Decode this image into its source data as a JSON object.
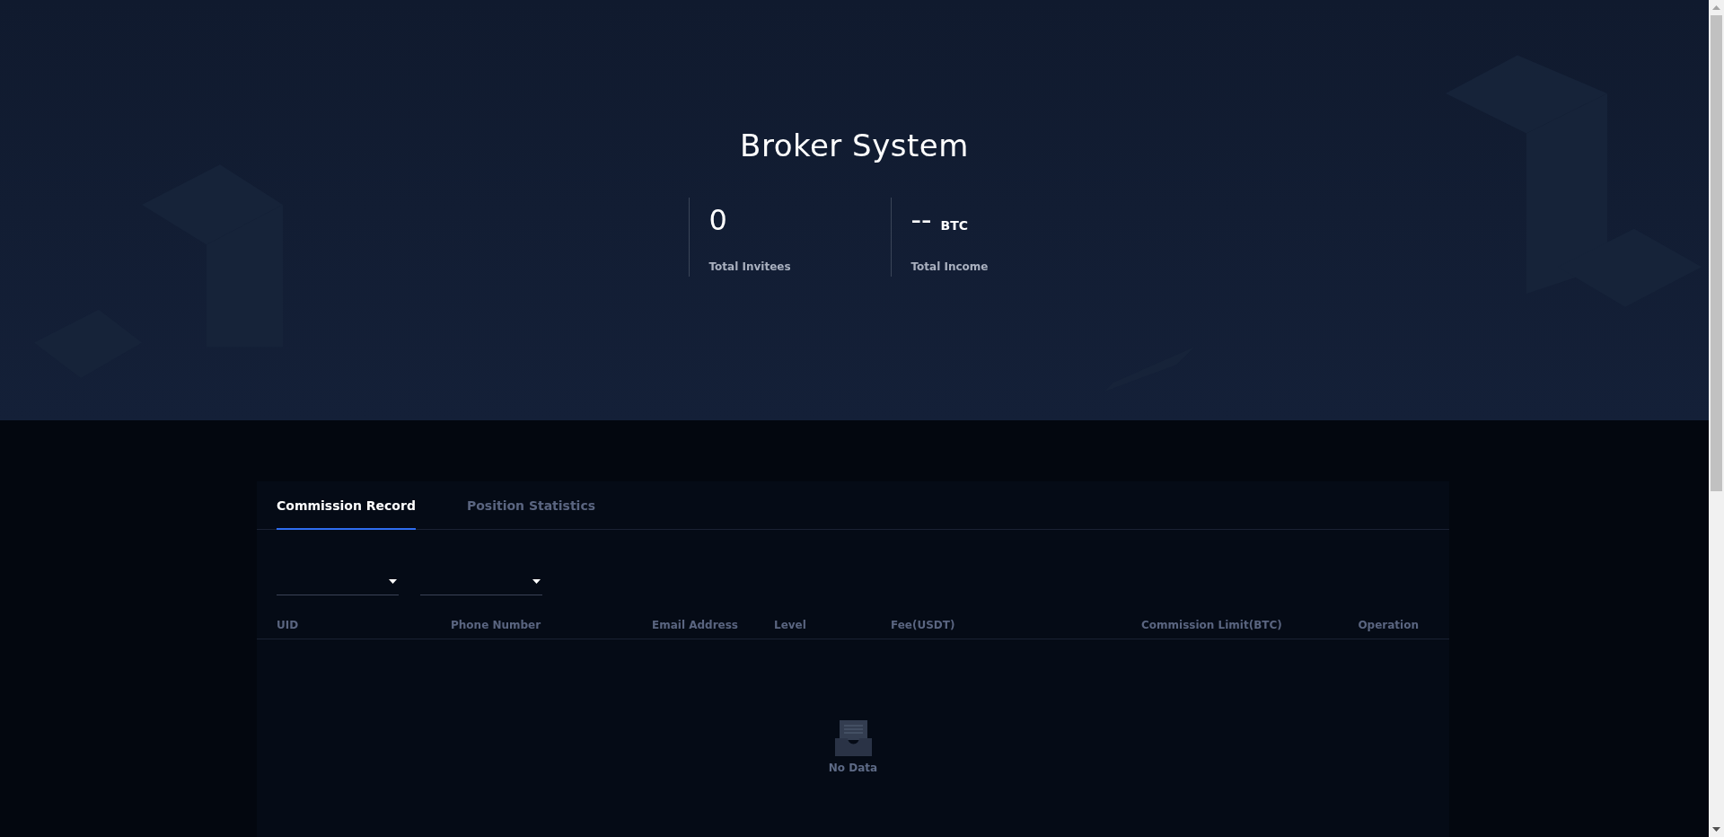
{
  "header": {
    "title": "Broker System",
    "stats": [
      {
        "value": "0",
        "label": "Total Invitees"
      },
      {
        "value": "--",
        "unit": "BTC",
        "label": "Total Income"
      }
    ]
  },
  "tabs": [
    {
      "label": "Commission Record",
      "selected": true
    },
    {
      "label": "Position Statistics",
      "selected": false
    }
  ],
  "filters": [
    {
      "kind": "dropdown"
    },
    {
      "kind": "dropdown"
    }
  ],
  "table": {
    "columns": [
      "UID",
      "Phone Number",
      "Email Address",
      "Level",
      "Fee(USDT)",
      "Commission Limit(BTC)",
      "Operation"
    ],
    "empty_text": "No Data"
  }
}
